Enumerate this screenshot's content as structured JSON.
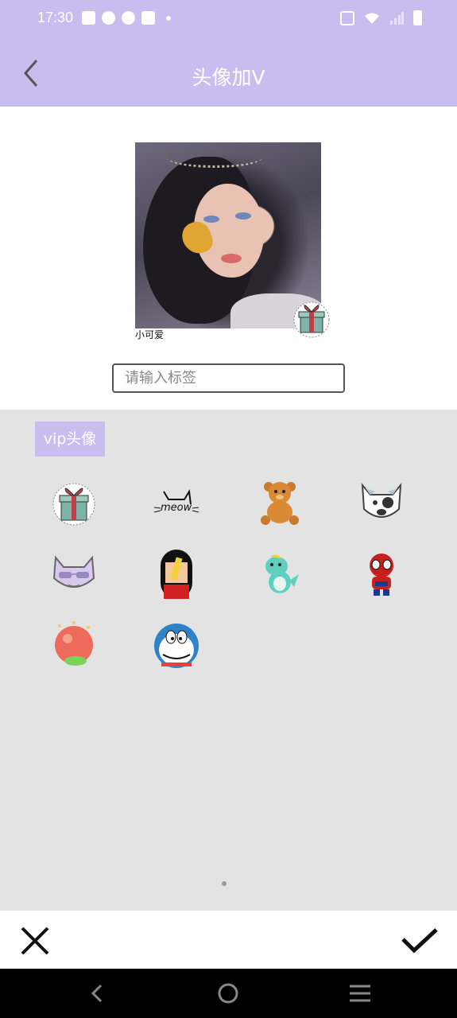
{
  "status_bar": {
    "time": "17:30",
    "left_icons": [
      "mail-icon",
      "compass-icon",
      "compass-icon",
      "mail-icon",
      "dot-icon"
    ],
    "right_icons": [
      "vibrate-icon",
      "wifi-icon",
      "signal-icon",
      "battery-icon"
    ]
  },
  "header": {
    "title": "头像加V",
    "back_icon": "chevron-left-icon",
    "background": "#c8bdee"
  },
  "preview": {
    "avatar_label": "小可爱",
    "badge_icon": "gift-box-sticker"
  },
  "tag_input": {
    "placeholder": "请输入标签",
    "value": ""
  },
  "panel": {
    "tab_label": "vip头像",
    "stickers": [
      {
        "name": "gift-box-sticker"
      },
      {
        "name": "meow-cat-sticker"
      },
      {
        "name": "teddy-bear-sticker"
      },
      {
        "name": "bulldog-sticker"
      },
      {
        "name": "sunglasses-cat-sticker"
      },
      {
        "name": "girl-sticker"
      },
      {
        "name": "dinosaur-sticker"
      },
      {
        "name": "spiderman-sticker"
      },
      {
        "name": "red-ball-sticker"
      },
      {
        "name": "doraemon-sticker"
      }
    ],
    "page_indicator": "1"
  },
  "actions": {
    "cancel_icon": "close-icon",
    "confirm_icon": "check-icon"
  },
  "nav": {
    "icons": [
      "back-icon",
      "home-icon",
      "menu-icon"
    ]
  },
  "colors": {
    "accent": "#c8bdee",
    "panel_bg": "#e3e3e3"
  }
}
